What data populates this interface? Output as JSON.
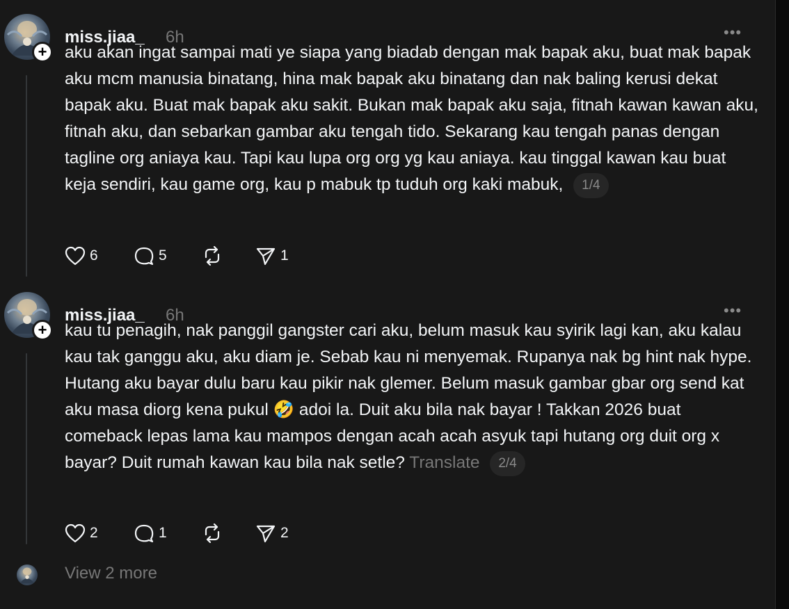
{
  "posts": [
    {
      "username": "miss.jiaa_",
      "time": "6h",
      "more": "•••",
      "text": "aku akan ingat sampai mati ye siapa yang biadab dengan mak bapak aku, buat mak bapak aku mcm manusia binatang, hina mak bapak aku binatang dan nak baling kerusi dekat bapak aku. Buat mak bapak aku sakit. Bukan mak bapak aku saja, fitnah kawan kawan aku, fitnah aku, dan sebarkan gambar aku tengah tido. Sekarang kau tengah panas dengan tagline org aniaya kau. Tapi kau lupa org org yg kau aniaya. kau tinggal kawan kau buat keja sendiri, kau game org, kau p mabuk tp tuduh org kaki mabuk,",
      "translate": "",
      "page": "1/4",
      "likes": "6",
      "replies": "5",
      "reposts": "",
      "shares": "1"
    },
    {
      "username": "miss.jiaa_",
      "time": "6h",
      "more": "•••",
      "text": "kau tu penagih, nak panggil gangster cari aku, belum masuk kau syirik lagi kan, aku kalau kau tak ganggu aku, aku diam je. Sebab kau ni menyemak. Rupanya nak bg hint nak hype. Hutang aku bayar dulu baru kau pikir nak glemer. Belum masuk gambar gbar org send kat aku masa diorg kena pukul 🤣 adoi la. Duit aku bila nak bayar ! Takkan 2026 buat comeback lepas lama kau mampos dengan acah acah asyuk tapi hutang org duit org x bayar? Duit rumah kawan kau bila nak setle?",
      "translate": "Translate",
      "page": "2/4",
      "likes": "2",
      "replies": "1",
      "reposts": "",
      "shares": "2"
    }
  ],
  "footer": {
    "view_more": "View 2 more"
  },
  "icons": {
    "like": "heart-icon",
    "reply": "comment-icon",
    "repost": "repost-icon",
    "share": "send-icon",
    "follow": "plus-icon"
  },
  "colors": {
    "background": "#181818",
    "text": "#f3f5f7",
    "muted": "#777777"
  }
}
